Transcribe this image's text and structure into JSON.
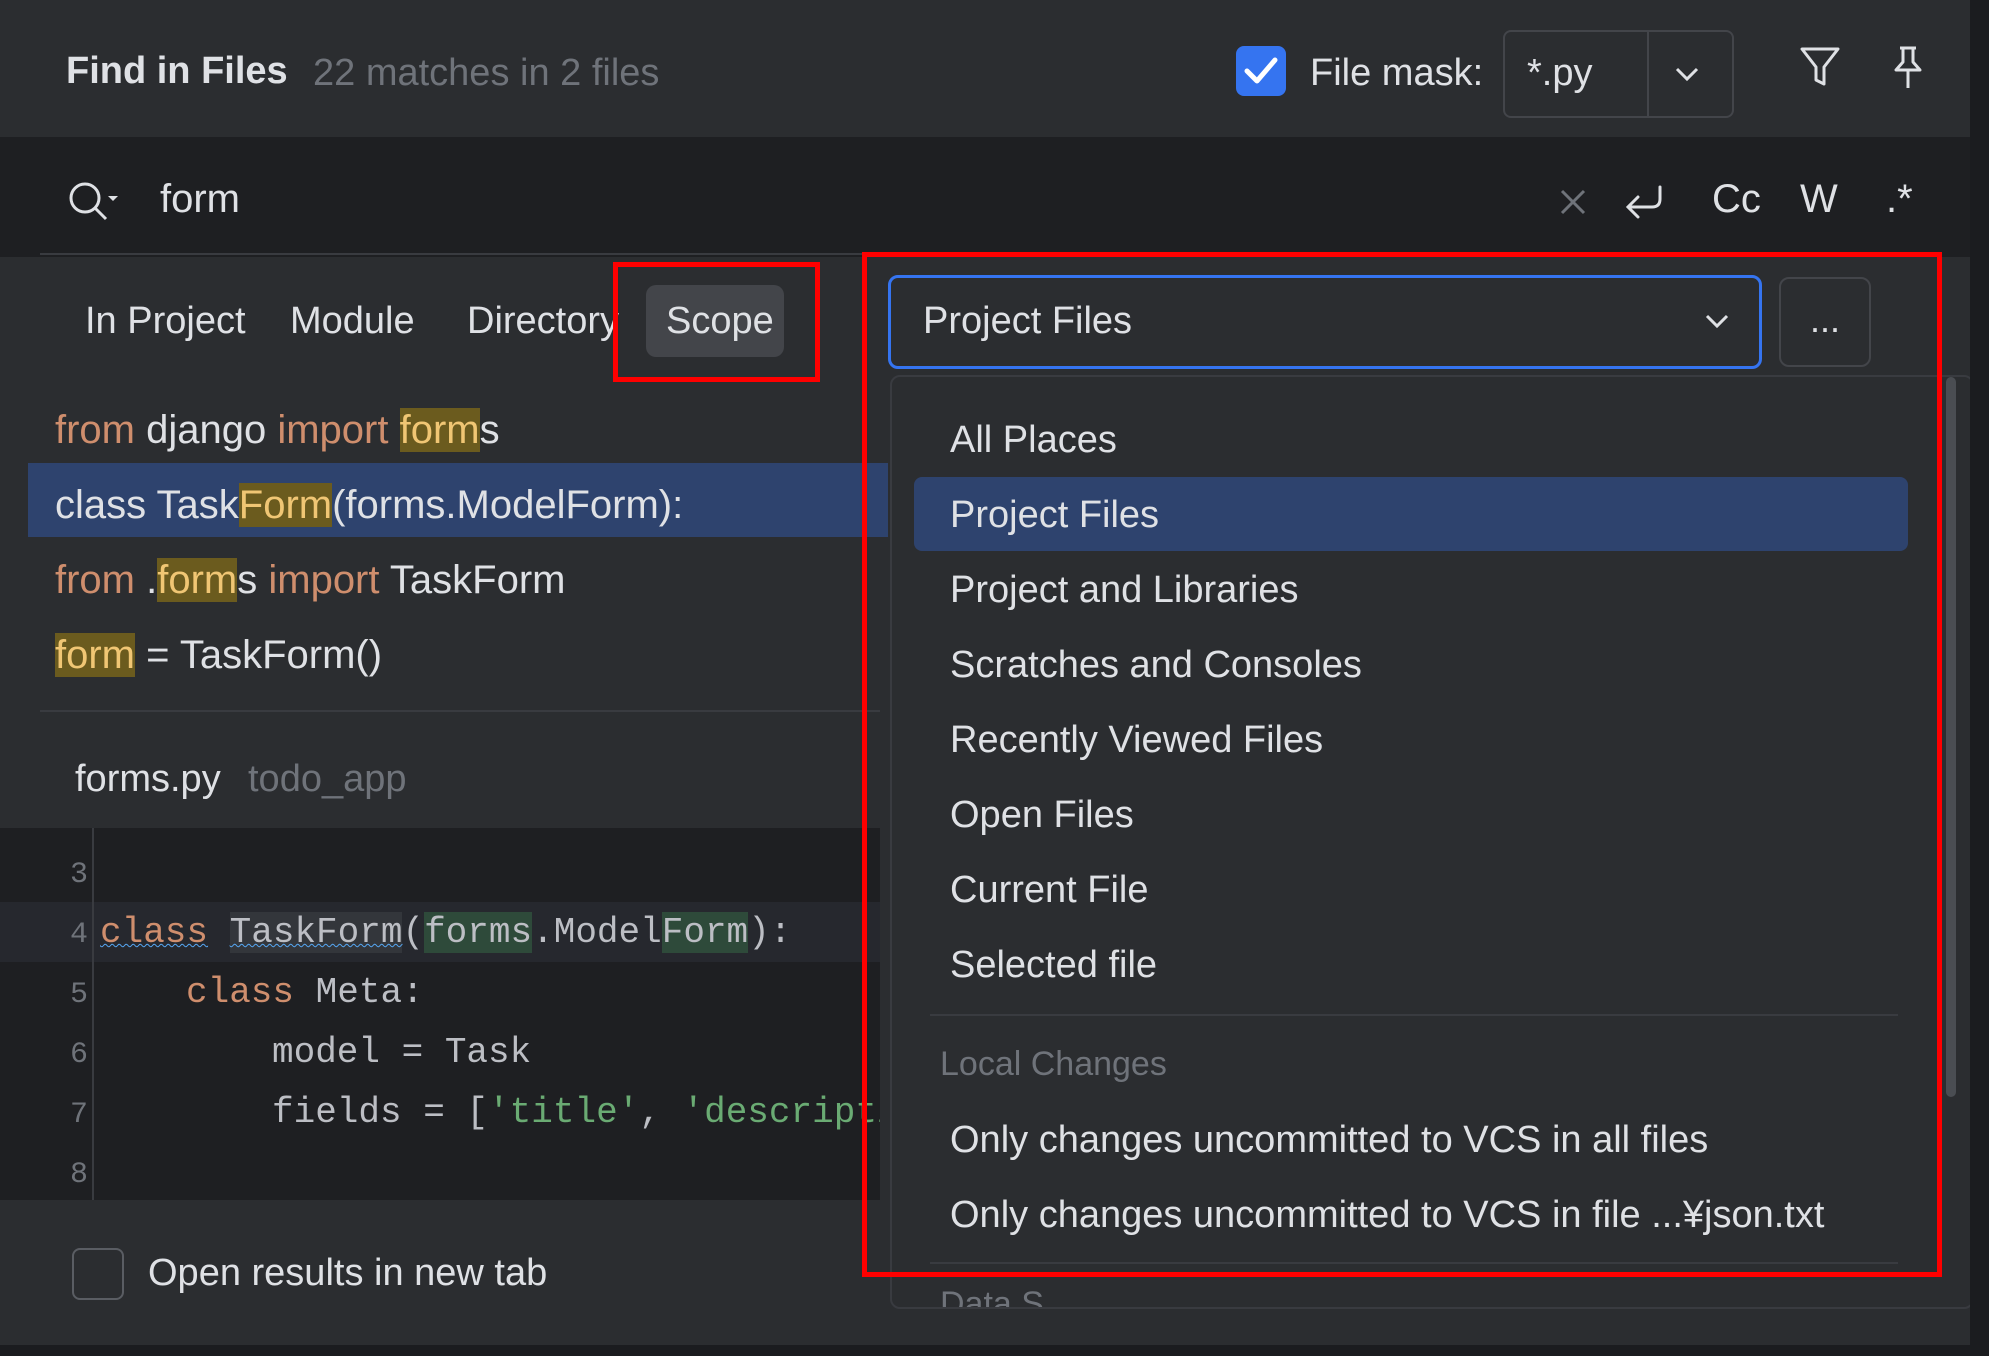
{
  "header": {
    "title": "Find in Files",
    "match_count": "22 matches in 2 files",
    "file_mask_checked": true,
    "file_mask_label": "File mask:",
    "file_mask_value": "*.py"
  },
  "search": {
    "query": "form",
    "case_label": "Cc",
    "words_label": "W",
    "regex_label": ".*"
  },
  "scope_tabs": {
    "in_project": "In Project",
    "module": "Module",
    "directory": "Directory",
    "scope": "Scope",
    "active": "Scope"
  },
  "results": [
    {
      "pre_kw": "from",
      "mid": " django ",
      "kw2": "import",
      "space": " ",
      "match": "form",
      "post": "s"
    },
    {
      "pre": "class Task",
      "match": "Form",
      "post": "(forms.ModelForm):"
    },
    {
      "pre_kw": "from",
      "dot": " .",
      "match": "form",
      "mid": "s ",
      "kw2": "import",
      "post": " TaskForm"
    },
    {
      "match": "form",
      "post": " = TaskForm()"
    }
  ],
  "preview": {
    "file_name": "forms.py",
    "file_path": "todo_app",
    "lines": [
      {
        "num": "3"
      },
      {
        "num": "4",
        "kw": "class",
        "name": "TaskForm",
        "p1": "(",
        "occ1": "forms",
        "p2": ".Model",
        "occ2": "Form",
        "p3": "):"
      },
      {
        "num": "5",
        "kw": "class",
        "rest": " Meta:"
      },
      {
        "num": "6",
        "rest": "model = Task"
      },
      {
        "num": "7",
        "rest": "fields = [",
        "s1": "'title'",
        "sep": ", ",
        "s2": "'descripti"
      },
      {
        "num": "8"
      }
    ]
  },
  "footer": {
    "open_new_tab_label": "Open results in new tab",
    "open_new_tab_checked": false
  },
  "scope_combo": {
    "value": "Project Files",
    "browse_label": "..."
  },
  "scope_popup": {
    "items": [
      "All Places",
      "Project Files",
      "Project and Libraries",
      "Scratches and Consoles",
      "Recently Viewed Files",
      "Open Files",
      "Current File",
      "Selected file"
    ],
    "selected": "Project Files",
    "group_label": "Local Changes",
    "group_items": [
      "Only changes uncommitted to VCS in all files",
      "Only changes uncommitted to VCS in file ...¥json.txt"
    ],
    "clipped_item": "Data S..."
  },
  "colors": {
    "accent": "#3574f0",
    "selection": "#2e436e",
    "keyword": "#cf8e6d",
    "match_highlight": "#6b5b1e",
    "annotation": "#ff0000"
  }
}
